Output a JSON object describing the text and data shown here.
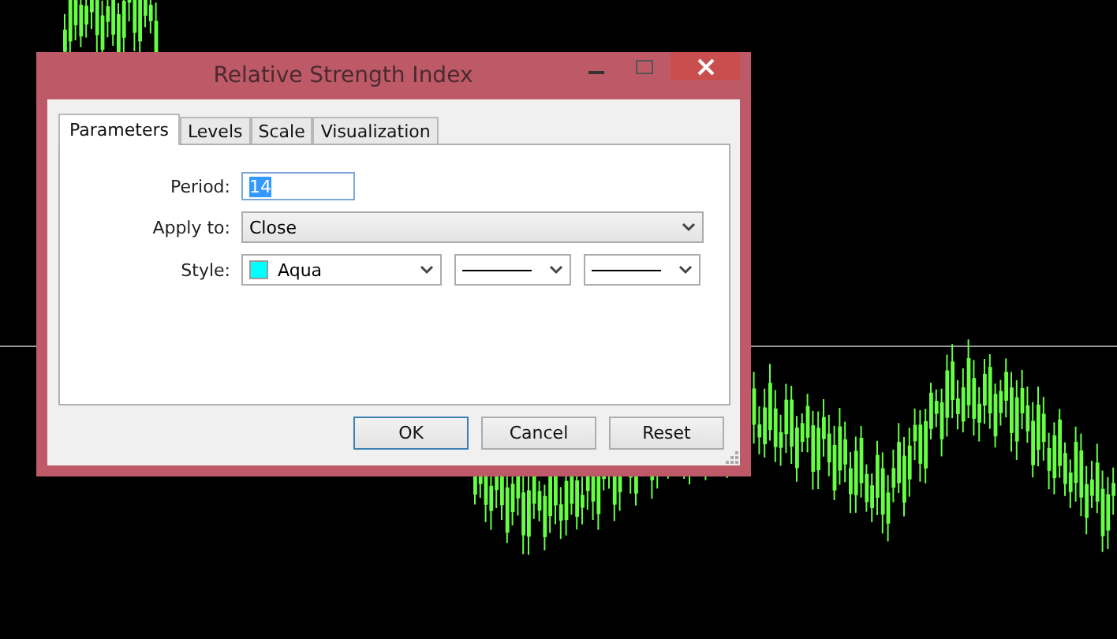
{
  "window": {
    "title": "Relative Strength Index"
  },
  "tabs": [
    {
      "label": "Parameters",
      "selected": true
    },
    {
      "label": "Levels",
      "selected": false
    },
    {
      "label": "Scale",
      "selected": false
    },
    {
      "label": "Visualization",
      "selected": false
    }
  ],
  "fields": [
    {
      "kind": "text",
      "label": "Period:",
      "value": "14",
      "text_selected": true
    },
    {
      "kind": "dropdown",
      "label": "Apply to:",
      "value": "Close"
    },
    {
      "kind": "style",
      "label": "Style:",
      "value": "Aqua",
      "color": "#00ffff"
    }
  ],
  "buttons": [
    {
      "label": "OK",
      "default": true
    },
    {
      "label": "Cancel",
      "default": false
    },
    {
      "label": "Reset",
      "default": false
    }
  ]
}
